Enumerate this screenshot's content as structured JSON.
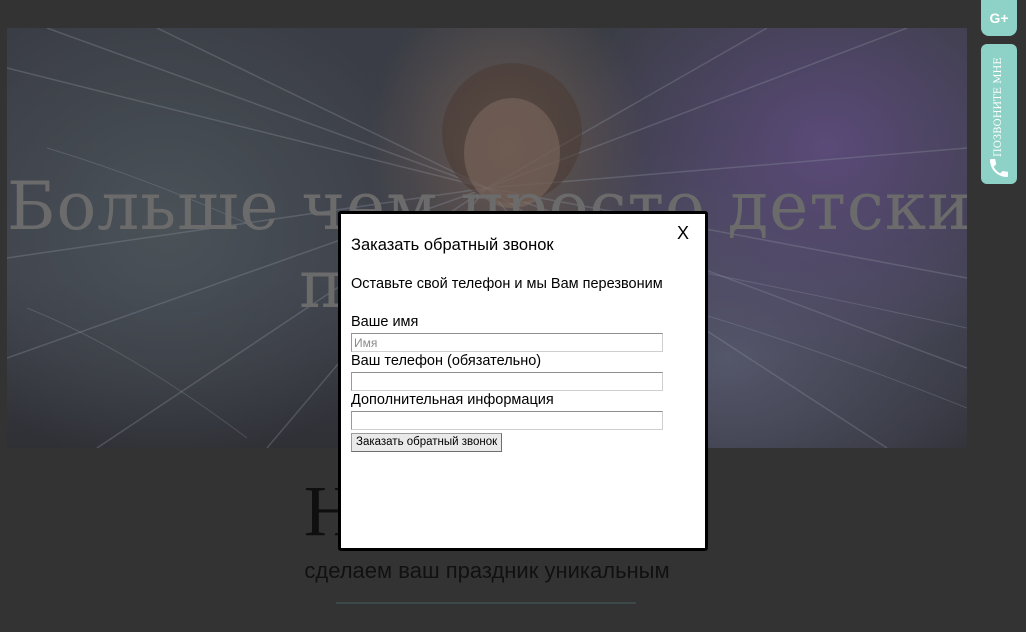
{
  "hero": {
    "title_line1": "Больше чем просто детские",
    "title_line2": "праздники"
  },
  "section": {
    "title": "Наш проект",
    "subtitle": "сделаем ваш праздник уникальным"
  },
  "side_widgets": {
    "gplus_label": "G+",
    "call_label": "ПОЗВОНИТЕ МНЕ",
    "accent_color": "#8ed1c6"
  },
  "modal": {
    "close_label": "X",
    "title": "Заказать обратный звонок",
    "description": "Оставьте свой телефон и мы Вам перезвоним",
    "fields": [
      {
        "label": "Ваше имя",
        "placeholder": "Имя",
        "value": ""
      },
      {
        "label": "Ваш телефон (обязательно)",
        "placeholder": "",
        "value": ""
      },
      {
        "label": "Дополнительная информация",
        "placeholder": "",
        "value": ""
      }
    ],
    "submit_label": "Заказать обратный звонок"
  }
}
